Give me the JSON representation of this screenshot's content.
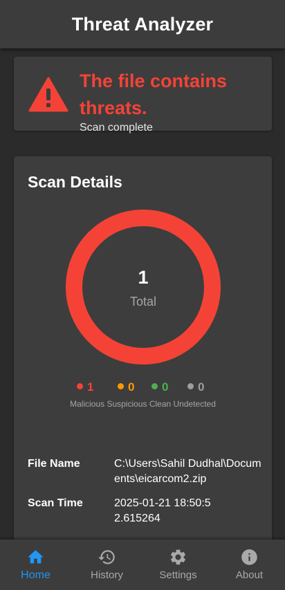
{
  "app": {
    "title": "Threat Analyzer"
  },
  "alert": {
    "icon": "warning-triangle-icon",
    "title": "The file contains threats.",
    "subtitle": "Scan complete",
    "color": "#f44336"
  },
  "scan_details": {
    "title": "Scan Details",
    "total": {
      "count": "1",
      "label": "Total"
    },
    "stats": [
      {
        "key": "malicious",
        "label": "Malicious",
        "count": "1",
        "color": "#f44336"
      },
      {
        "key": "suspicious",
        "label": "Suspicious",
        "count": "0",
        "color": "#ff9800"
      },
      {
        "key": "clean",
        "label": "Clean",
        "count": "0",
        "color": "#4caf50"
      },
      {
        "key": "undetected",
        "label": "Undetected",
        "count": "0",
        "color": "#9e9e9e"
      }
    ],
    "legend_text": "Malicious Suspicious Clean Undetected",
    "info": [
      {
        "label": "File Name",
        "value": "C:\\Users\\Sahil Dudhal\\Documents\\eicarcom2.zip"
      },
      {
        "label": "Scan Time",
        "value": "2025-01-21 18:50:52.615264"
      }
    ]
  },
  "nav": {
    "items": [
      {
        "label": "Home",
        "icon": "home-icon",
        "active": true
      },
      {
        "label": "History",
        "icon": "history-icon",
        "active": false
      },
      {
        "label": "Settings",
        "icon": "settings-icon",
        "active": false
      },
      {
        "label": "About",
        "icon": "info-icon",
        "active": false
      }
    ],
    "active_color": "#2196f3",
    "inactive_color": "#a9a9a9"
  }
}
